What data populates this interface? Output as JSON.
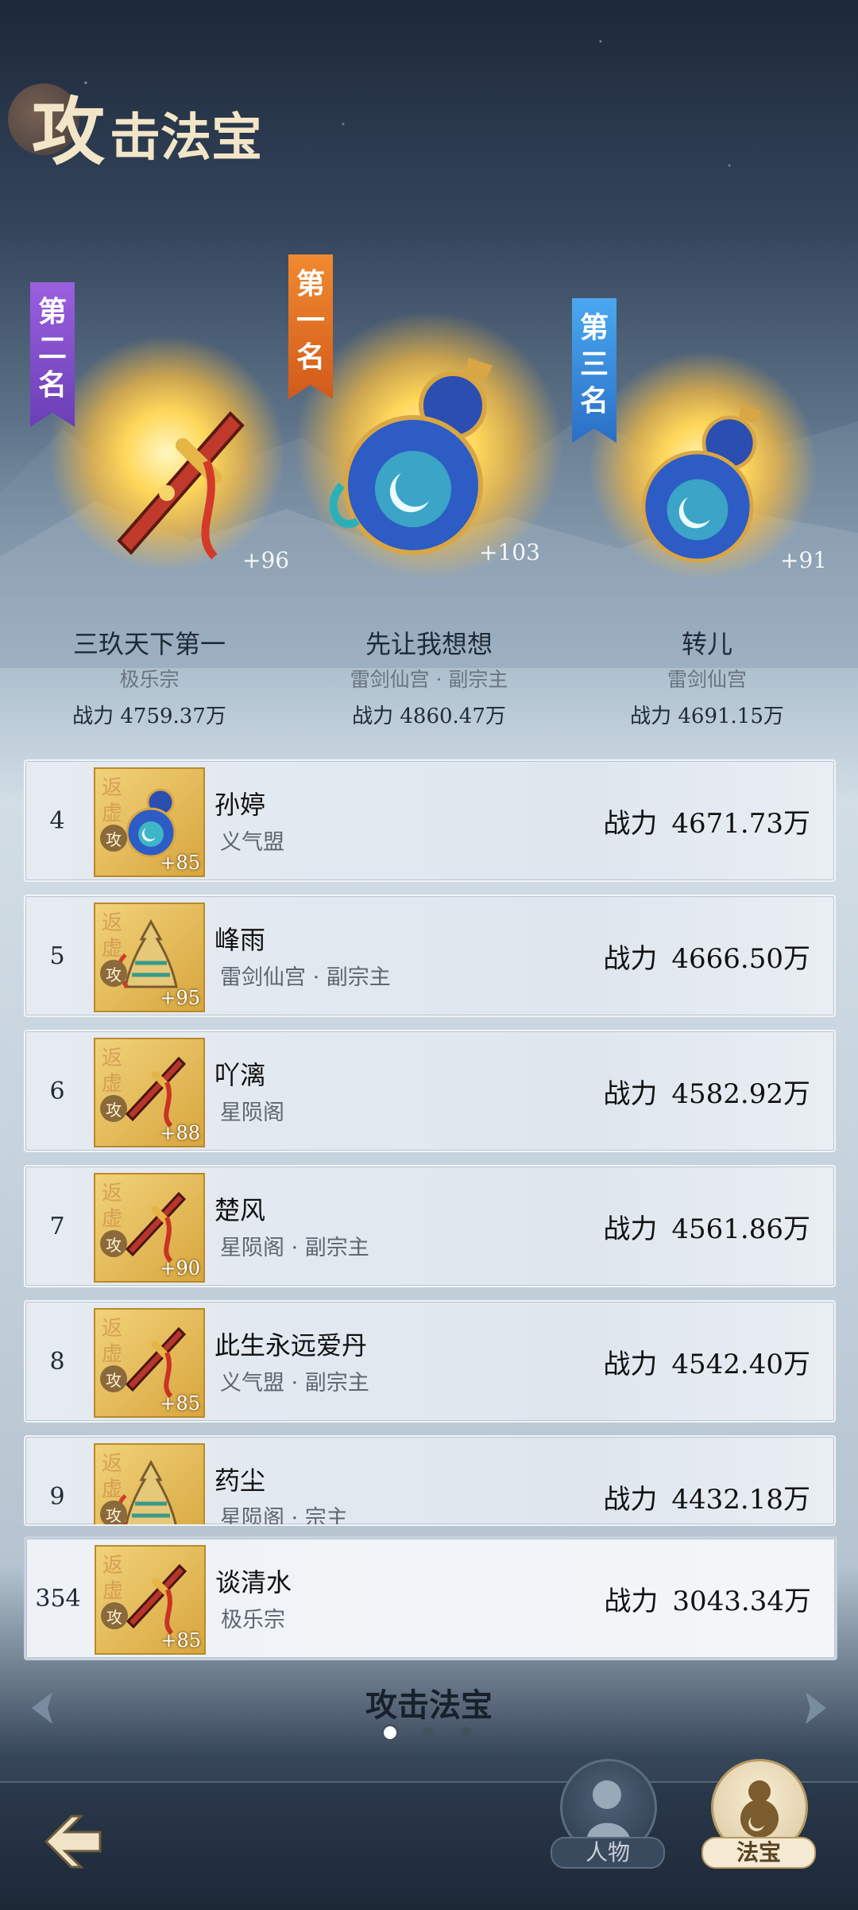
{
  "header": {
    "title_big": "攻",
    "title_rest": "击法宝"
  },
  "podium": [
    {
      "rank_label": "第二名",
      "plus": "+96",
      "name": "三玖天下第一",
      "sect": "极乐宗",
      "power": "战力 4759.37万",
      "banner_color": "#7b4bd0"
    },
    {
      "rank_label": "第一名",
      "plus": "+103",
      "name": "先让我想想",
      "sect": "雷剑仙宫 · 副宗主",
      "power": "战力 4860.47万",
      "banner_color": "#e0702a"
    },
    {
      "rank_label": "第三名",
      "plus": "+91",
      "name": "转儿",
      "sect": "雷剑仙宫",
      "power": "战力 4691.15万",
      "banner_color": "#3a8ee0"
    }
  ],
  "list": {
    "power_label": "战力",
    "watermark": "返虚",
    "atk_badge": "攻",
    "rows": [
      {
        "rank": "4",
        "name": "孙婷",
        "sect": "义气盟",
        "power": "4671.73万",
        "plus": "+85",
        "icon": "gourd-icon"
      },
      {
        "rank": "5",
        "name": "峰雨",
        "sect": "雷剑仙宫 · 副宗主",
        "power": "4666.50万",
        "plus": "+95",
        "icon": "bell-icon"
      },
      {
        "rank": "6",
        "name": "吖漓",
        "sect": "星陨阁",
        "power": "4582.92万",
        "plus": "+88",
        "icon": "sword-icon"
      },
      {
        "rank": "7",
        "name": "楚风",
        "sect": "星陨阁 · 副宗主",
        "power": "4561.86万",
        "plus": "+90",
        "icon": "sword-icon"
      },
      {
        "rank": "8",
        "name": "此生永远爱丹",
        "sect": "义气盟 · 副宗主",
        "power": "4542.40万",
        "plus": "+85",
        "icon": "sword-icon"
      },
      {
        "rank": "9",
        "name": "药尘",
        "sect": "星陨阁 · 宗主",
        "power": "4432.18万",
        "plus": "",
        "icon": "bell-icon"
      }
    ],
    "me": {
      "rank": "354",
      "name": "谈清水",
      "sect": "极乐宗",
      "power": "3043.34万",
      "plus": "+85",
      "icon": "sword-icon"
    }
  },
  "footer": {
    "category_title": "攻击法宝",
    "page_dots": 3,
    "active_page": 1,
    "tabs": [
      {
        "label": "人物"
      },
      {
        "label": "法宝"
      }
    ]
  }
}
